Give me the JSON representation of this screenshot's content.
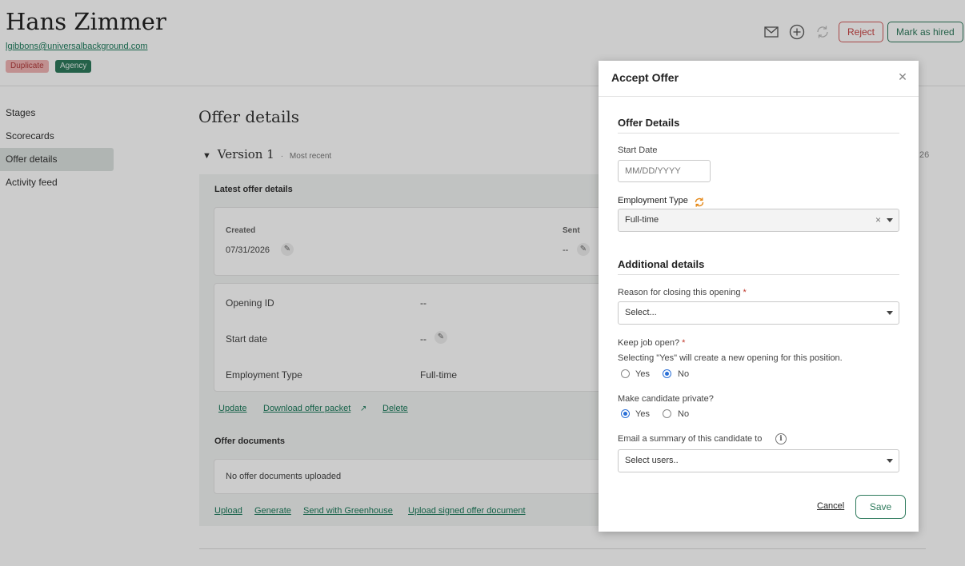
{
  "candidate": {
    "name": "Hans Zimmer",
    "email": "lgibbons@universalbackground.com",
    "badges": [
      "Duplicate",
      "Agency"
    ]
  },
  "header_actions": {
    "icons": [
      "mail-icon",
      "add-icon",
      "sync-icon"
    ],
    "reject_label": "Reject",
    "hired_label": "Mark as hired"
  },
  "sidebar": {
    "items": [
      {
        "label": "Stages"
      },
      {
        "label": "Scorecards"
      },
      {
        "label": "Offer details"
      },
      {
        "label": "Activity feed"
      }
    ],
    "active": "Offer details"
  },
  "offer": {
    "section_title": "Offer details",
    "version_label": "Version 1",
    "version_sep": "·",
    "version_note": "Most recent",
    "right_partial_text": "26",
    "latest_title": "Latest offer details",
    "created_label": "Created",
    "created_value": "07/31/2026",
    "sent_label": "Sent",
    "sent_value": "--",
    "rows": [
      {
        "label": "Opening ID",
        "value": "--"
      },
      {
        "label": "Start date",
        "value": "--"
      },
      {
        "label": "Employment Type",
        "value": "Full-time"
      }
    ],
    "links": [
      "Update",
      "Download offer packet",
      "Delete"
    ],
    "documents_title": "Offer documents",
    "no_documents": "No offer documents uploaded",
    "doc_links": [
      "Upload",
      "Generate",
      "Send with Greenhouse",
      "Upload signed offer document"
    ]
  },
  "modal": {
    "title": "Accept Offer",
    "section1": "Offer Details",
    "start_date_label": "Start Date",
    "start_date_placeholder": "MM/DD/YYYY",
    "employment_type_label": "Employment Type",
    "employment_type_value": "Full-time",
    "section2": "Additional details",
    "reason_label": "Reason for closing this opening",
    "reason_placeholder": "Select...",
    "keep_open_label": "Keep job open?",
    "keep_open_help": "Selecting \"Yes\" will create a new opening for this position.",
    "keep_open_options": [
      "Yes",
      "No"
    ],
    "keep_open_selected": "No",
    "private_label": "Make candidate private?",
    "private_options": [
      "Yes",
      "No"
    ],
    "private_selected": "Yes",
    "email_summary_label": "Email a summary of this candidate to",
    "email_summary_placeholder": "Select users..",
    "required_mark": "*",
    "cancel_label": "Cancel",
    "save_label": "Save"
  }
}
